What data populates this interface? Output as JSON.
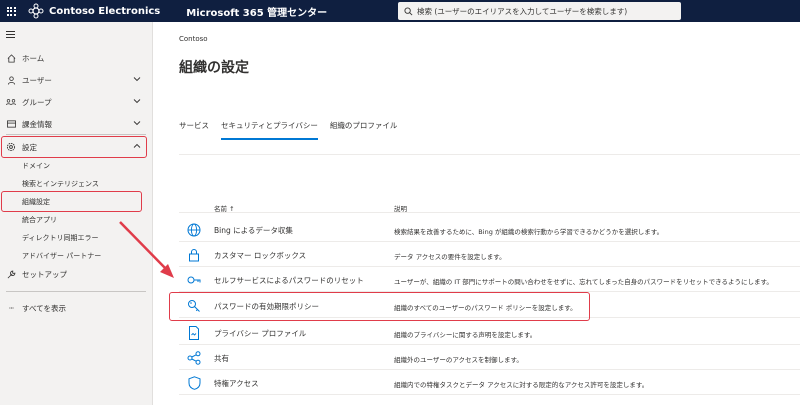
{
  "colors": {
    "topbar": "#0f1f40",
    "accent": "#0078d4",
    "highlight": "#e03c4a",
    "icon": "#0078d4"
  },
  "header": {
    "brand": "Contoso Electronics",
    "product": "Microsoft 365 管理センター",
    "search_placeholder": "検索 (ユーザーのエイリアスを入力してユーザーを検索します)"
  },
  "sidebar": {
    "items": [
      {
        "label": "ホーム",
        "icon": "home-icon"
      },
      {
        "label": "ユーザー",
        "icon": "person-icon"
      },
      {
        "label": "グループ",
        "icon": "group-icon"
      },
      {
        "label": "課金情報",
        "icon": "billing-icon"
      },
      {
        "label": "設定",
        "icon": "gear-icon"
      },
      {
        "label": "セットアップ",
        "icon": "wrench-icon"
      },
      {
        "label": "すべてを表示",
        "icon": "more-icon"
      }
    ],
    "sub_items": [
      "ドメイン",
      "検索とインテリジェンス",
      "組織設定",
      "統合アプリ",
      "ディレクトリ同期エラー",
      "アドバイザー パートナー"
    ]
  },
  "main": {
    "breadcrumb": "Contoso",
    "title": "組織の設定",
    "tabs": [
      "サービス",
      "セキュリティとプライバシー",
      "組織のプロファイル"
    ],
    "active_tab": "セキュリティとプライバシー",
    "columns": {
      "name": "名前 ↑",
      "desc": "説明"
    },
    "rows": [
      {
        "name": "Bing によるデータ収集",
        "desc": "検索結果を改善するために、Bing が組織の検索行動から学習できるかどうかを選択します。",
        "icon": "globe-icon"
      },
      {
        "name": "カスタマー ロックボックス",
        "desc": "データ アクセスの要件を設定します。",
        "icon": "lock-icon"
      },
      {
        "name": "セルフサービスによるパスワードのリセット",
        "desc": "ユーザーが、組織の IT 部門にサポートの問い合わせをせずに、忘れてしまった自身のパスワードをリセットできるようにします。",
        "icon": "key-reset-icon"
      },
      {
        "name": "パスワードの有効期限ポリシー",
        "desc": "組織のすべてのユーザーのパスワード ポリシーを設定します。",
        "icon": "key-icon"
      },
      {
        "name": "プライバシー プロファイル",
        "desc": "組織のプライバシーに関する声明を設定します。",
        "icon": "document-icon"
      },
      {
        "name": "共有",
        "desc": "組織外のユーザーのアクセスを制御します。",
        "icon": "share-icon"
      },
      {
        "name": "特権アクセス",
        "desc": "組織内での特権タスクとデータ アクセスに対する限定的なアクセス許可を設定します。",
        "icon": "shield-icon"
      }
    ]
  }
}
